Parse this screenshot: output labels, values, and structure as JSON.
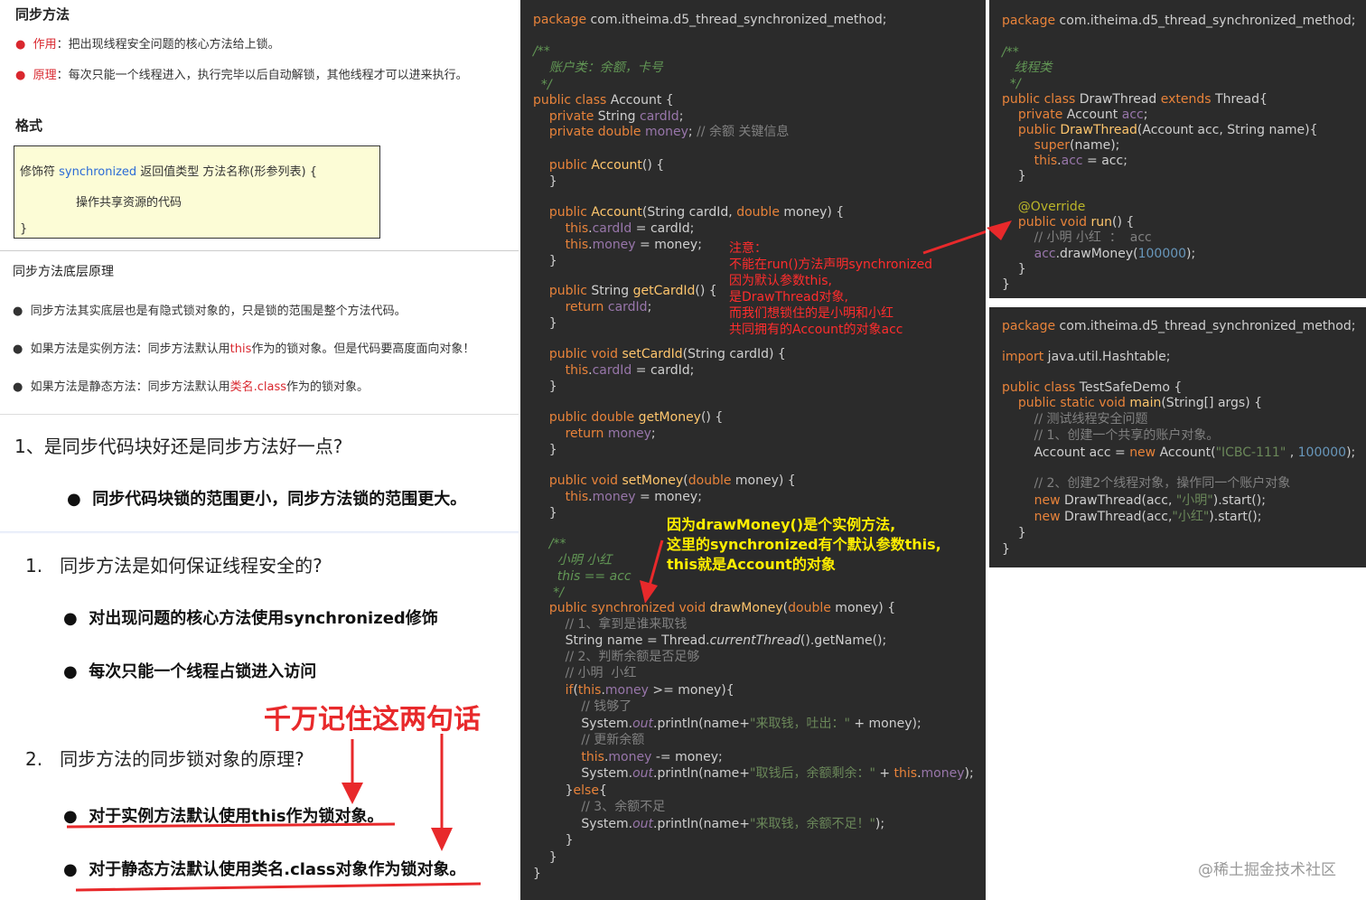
{
  "left": {
    "title1": "同步方法",
    "bullet1_label": "作用",
    "bullet1_text": "：把出现线程安全问题的核心方法给上锁。",
    "bullet2_label": "原理",
    "bullet2_text": "：每次只能一个线程进入，执行完毕以后自动解锁，其他线程才可以进来执行。",
    "format_title": "格式",
    "format_line1_a": "修饰符 ",
    "format_line1_kw": "synchronized",
    "format_line1_b": " 返回值类型 方法名称(形参列表) {",
    "format_line2": "操作共享资源的代码",
    "format_line3": "}",
    "principle_title": "同步方法底层原理",
    "p1": "同步方法其实底层也是有隐式锁对象的，只是锁的范围是整个方法代码。",
    "p2_a": "如果方法是实例方法：同步方法默认用",
    "p2_kw": "this",
    "p2_b": "作为的锁对象。但是代码要高度面向对象！",
    "p3_a": "如果方法是静态方法：同步方法默认用",
    "p3_kw": "类名.class",
    "p3_b": "作为的锁对象。",
    "q1": "1、是同步代码块好还是同步方法好一点?",
    "a1": "同步代码块锁的范围更小，同步方法锁的范围更大。",
    "q2_num": "1.",
    "q2": "同步方法是如何保证线程安全的?",
    "a2_1": "对出现问题的核心方法使用synchronized修饰",
    "a2_2": "每次只能一个线程占锁进入访问",
    "remember": "千万记住这两句话",
    "q3_num": "2.",
    "q3": "同步方法的同步锁对象的原理?",
    "a3_1": "对于实例方法默认使用this作为锁对象。",
    "a3_2": "对于静态方法默认使用类名.class对象作为锁对象。"
  },
  "mid": {
    "note_red": [
      "注意：",
      "不能在run()方法声明synchronized",
      "因为默认参数this,",
      "是DrawThread对象,",
      "而我们想锁住的是小明和小红",
      "共同拥有的Account的对象acc"
    ],
    "note_yel": [
      "因为drawMoney()是个实例方法,",
      "这里的synchronized有个默认参数this,",
      "this就是Account的对象"
    ]
  },
  "right": {
    "watermark": "@稀土掘金技术社区"
  },
  "colors": {
    "code_bg": "#2b2b2b",
    "keyword": "#e8833a",
    "method": "#ffc66d",
    "field": "#9876aa",
    "string": "#6a8759",
    "comment": "#808080",
    "accent_red": "#e8292b"
  }
}
